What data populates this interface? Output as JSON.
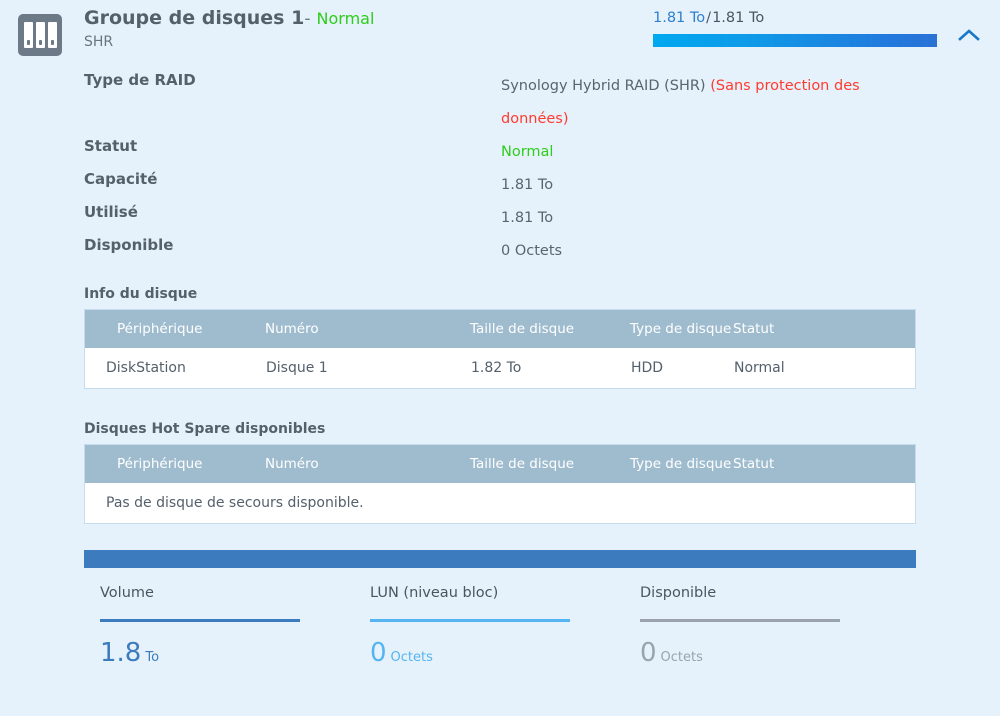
{
  "header": {
    "icon": "disk-group-icon",
    "title": "Groupe de disques 1",
    "dash": "-",
    "status": "Normal",
    "subtitle": "SHR",
    "collapse_icon": "chevron-up-icon"
  },
  "capacity": {
    "used": "1.81 To",
    "separator": "/",
    "total": "1.81 To",
    "percent": 100,
    "fill_start_color": "#00a8f0",
    "fill_end_color": "#2a72d6"
  },
  "details": [
    {
      "label": "Type de RAID",
      "value": "Synology Hybrid RAID (SHR) ",
      "value_warning": "(Sans protection des données)",
      "value_color": "#5a646f",
      "warning_color": "#ff3b30"
    },
    {
      "label": "Statut",
      "value": "Normal",
      "value_color": "#2ecc1b"
    },
    {
      "label": "Capacité",
      "value": "1.81 To",
      "value_color": "#5a646f"
    },
    {
      "label": "Utilisé",
      "value": "1.81 To",
      "value_color": "#5a646f"
    },
    {
      "label": "Disponible",
      "value": "0 Octets",
      "value_color": "#5a646f"
    }
  ],
  "disk_info": {
    "section_title": "Info du disque",
    "columns": [
      "Périphérique",
      "Numéro",
      "Taille de disque",
      "Type de disque",
      "Statut"
    ],
    "rows": [
      {
        "device": "DiskStation",
        "number": "Disque 1",
        "size": "1.82 To",
        "type": "HDD",
        "status": "Normal",
        "status_color": "#2ecc1b"
      }
    ]
  },
  "hot_spare": {
    "section_title": "Disques Hot Spare disponibles",
    "columns": [
      "Périphérique",
      "Numéro",
      "Taille de disque",
      "Type de disque",
      "Statut"
    ],
    "empty_message": "Pas de disque de secours disponible.",
    "rows": []
  },
  "allocation": {
    "bar_color": "#3c83ca",
    "segments": [
      {
        "name": "Volume",
        "percent": 100,
        "color": "#3c83ca"
      },
      {
        "name": "LUN (niveau bloc)",
        "percent": 0,
        "color": "#55b4f2"
      },
      {
        "name": "Disponible",
        "percent": 0,
        "color": "#9aa3ab"
      }
    ],
    "legend": [
      {
        "label": "Volume",
        "number": "1.8",
        "unit": "To",
        "color": "#3c7cbe"
      },
      {
        "label": "LUN (niveau bloc)",
        "number": "0",
        "unit": "Octets",
        "color": "#55b4f2"
      },
      {
        "label": "Disponible",
        "number": "0",
        "unit": "Octets",
        "color": "#9aa3ab"
      }
    ]
  }
}
